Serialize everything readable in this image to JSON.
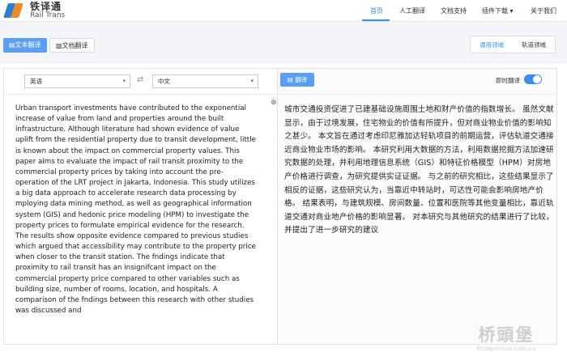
{
  "brand": {
    "name_cn": "铁译通",
    "name_en": "Rail Trans"
  },
  "nav": {
    "items": [
      {
        "label": "首页",
        "active": true
      },
      {
        "label": "人工翻译"
      },
      {
        "label": "文档支持"
      },
      {
        "label": "插件下载 ▾"
      },
      {
        "label": "关于我们"
      }
    ]
  },
  "modes": {
    "text": "文本翻译",
    "document": "文档翻译"
  },
  "domains": {
    "general": "通用领域",
    "rail": "轨道领域"
  },
  "lang": {
    "source": "英语",
    "target": "中文",
    "swap_icon": "⇄"
  },
  "translate_label": "翻译",
  "realtime": {
    "label": "即时翻译",
    "enabled": true
  },
  "source_text": "Urban transport investments have contributed to the exponential increase of value from land and properties around the built infrastructure. Although literature had shown evidence of value uplift from the residential property due to transit development, little is known about the impact on commercial property values. This paper aims to evaluate the impact of rail transit proximity to the commercial property prices by taking into account the pre-operation of the LRT project in Jakarta, Indonesia. This study utilizes a big data approach to accelerate research data processing by mploying data mining method, as well as geographical information system (GIS) and hedonic price modeling (HPM) to investigate the property prices to formulate empirical evidence for the research. The results show opposite evidence compared to previous studies which argued that accessibility may contribute to the property price when closer to the transit station. The fndings indicate that proximity to rail transit has an insignifcant impact on the commercial property price compared to other variables such as building size, number of rooms, location, and hospitals. A comparison of the fndings between this research with other studies was discussed and",
  "target_text": "城市交通投资促进了已建基础设施周围土地和财产价值的指数增长。 虽然文献显示，由于过境发展，住宅物业的价值有所提升，但对商业物业价值的影响知之甚少。 本文旨在通过考虑印尼雅加达轻轨项目的前期运营，评估轨道交通接近商业物业市场的影响。 本研究利用大数据的方法，利用数据挖掘方法加速研究数据的处理，并利用地理信息系统（GIS）和特征价格模型（HPM）对房地产价格进行调查，为研究提供实证证据。 与之前的研究相比，这些结果显示了相反的证据，这些研究认为，当靠近中转站时，可达性可能会影响房地产价格。 结果表明，与建筑规模、房间数量、位置和医院等其他变量相比，靠近轨道交通对商业地产价格的影响显著。 对本研究与其他研究的结果进行了比较，并提出了进一步研究的建议",
  "watermark": {
    "cn": "桥頭堡",
    "en": "Bridgehead.com.cn"
  }
}
